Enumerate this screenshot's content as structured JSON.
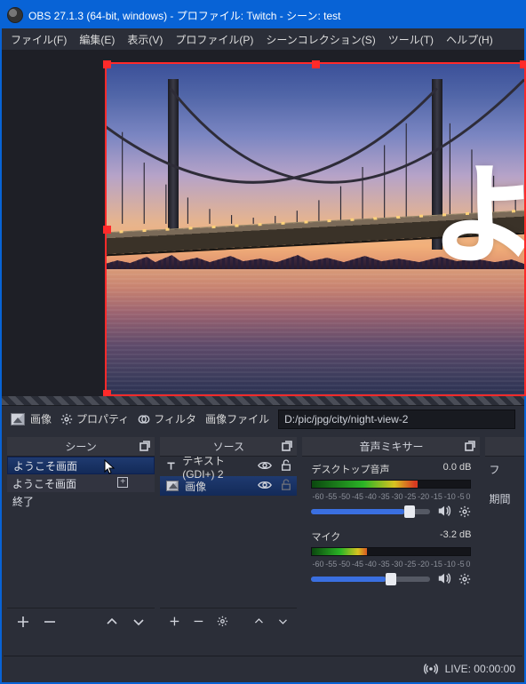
{
  "title": "OBS 27.1.3 (64-bit, windows) - プロファイル: Twitch - シーン: test",
  "menu": {
    "file": "ファイル(F)",
    "edit": "編集(E)",
    "view": "表示(V)",
    "profile": "プロファイル(P)",
    "scenecol": "シーンコレクション(S)",
    "tools": "ツール(T)",
    "help": "ヘルプ(H)"
  },
  "overlay_text": "よ",
  "propbar": {
    "source_label": "画像",
    "properties": "プロパティ",
    "filters": "フィルタ",
    "field_label": "画像ファイル",
    "path": "D:/pic/jpg/city/night-view-2"
  },
  "docks": {
    "scenes": {
      "title": "シーン",
      "items": [
        "ようこそ画面",
        "ようこそ画面",
        "終了"
      ]
    },
    "sources": {
      "title": "ソース",
      "items": [
        {
          "label": "テキスト (GDI+) 2",
          "type": "text"
        },
        {
          "label": "画像",
          "type": "image"
        }
      ]
    },
    "mixer": {
      "title": "音声ミキサー",
      "desktop": {
        "label": "デスクトップ音声",
        "db": "0.0 dB"
      },
      "mic": {
        "label": "マイク",
        "db": "-3.2 dB"
      },
      "ticks": [
        "-60",
        "-55",
        "-50",
        "-45",
        "-40",
        "-35",
        "-30",
        "-25",
        "-20",
        "-15",
        "-10",
        "-5",
        "0"
      ]
    },
    "extra": {
      "line1": "フ",
      "line2": "期間"
    }
  },
  "status": {
    "live_label": "LIVE: 00:00:00"
  }
}
